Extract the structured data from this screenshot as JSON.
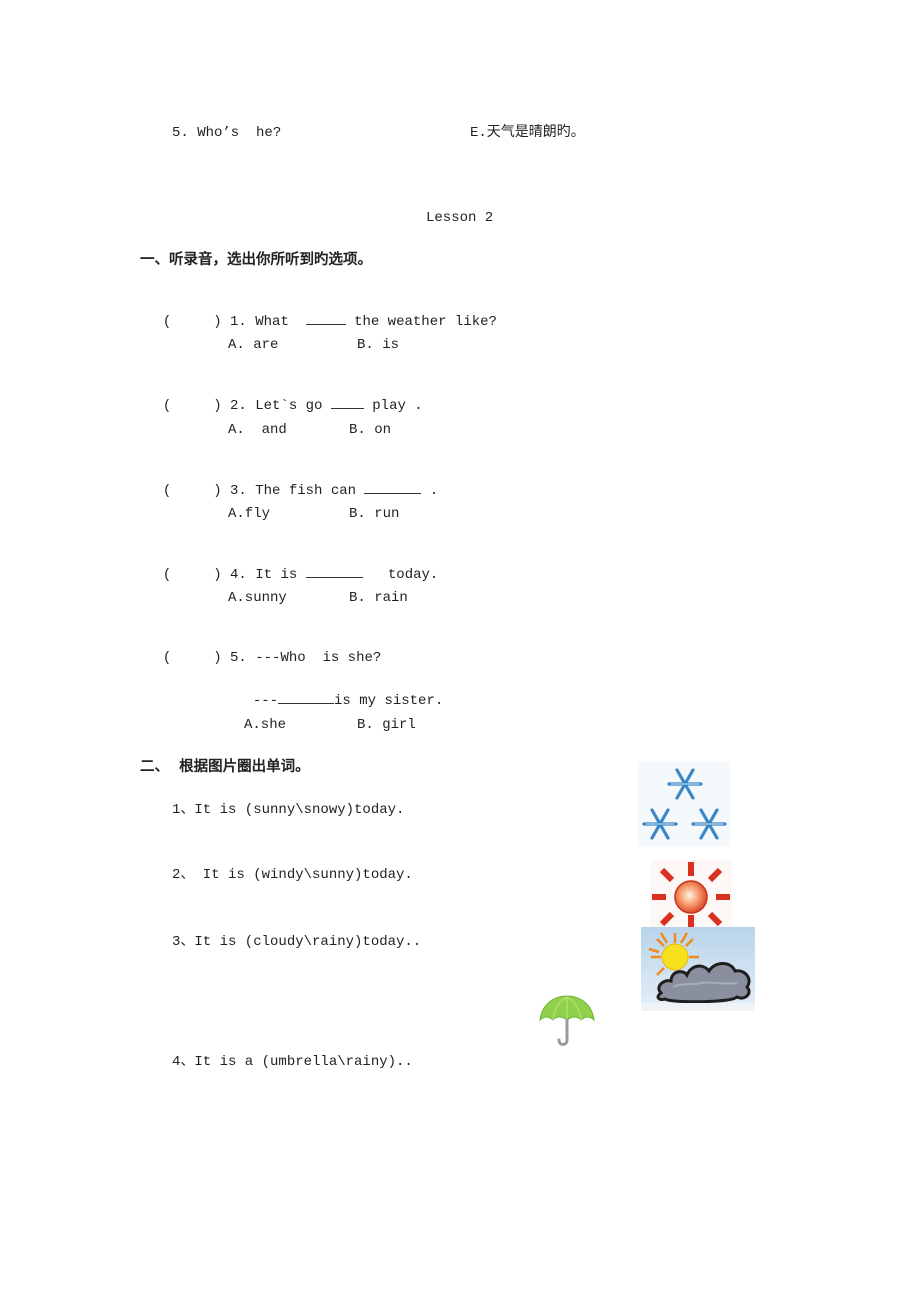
{
  "prev_item": {
    "question": "5. Who’s  he?",
    "answer": "E.天气是晴朗旳。"
  },
  "lesson_title": "Lesson 2",
  "section1": {
    "heading": "一、听录音，选出你所听到旳选项。",
    "items": [
      {
        "paren": "(     )",
        "number": "1.",
        "before": "What",
        "after": "the weather like?",
        "options": [
          "A. are",
          "B. is"
        ]
      },
      {
        "paren": "(     )",
        "number": "2.",
        "before": "Let`s go",
        "after": "play .",
        "options": [
          "A.  and",
          "B. on"
        ]
      },
      {
        "paren": "(     )",
        "number": "3.",
        "before": "The fish can",
        "after": ".",
        "options": [
          "A.fly",
          "B. run"
        ]
      },
      {
        "paren": "(     )",
        "number": "4.",
        "before": "It is",
        "after": "today.",
        "options": [
          "A.sunny",
          "B. rain"
        ]
      },
      {
        "paren": "(     )",
        "number": "5.",
        "before": "---Who  is she?",
        "second_line_prefix": "---",
        "second_line_after": "is my sister.",
        "options": [
          "A.she",
          "B. girl"
        ]
      }
    ]
  },
  "section2": {
    "heading": "二、  根据图片圈出单词。",
    "items": [
      {
        "text": "1、It is (sunny\\snowy)today.",
        "image": "snowflakes-icon"
      },
      {
        "text": "2、 It is (windy\\sunny)today.",
        "image": "sun-icon"
      },
      {
        "text": "3、It is (cloudy\\rainy)today..",
        "image": "sun-cloud-icon"
      },
      {
        "text": "4、It is a (umbrella\\rainy)..",
        "image": "umbrella-icon"
      }
    ]
  }
}
